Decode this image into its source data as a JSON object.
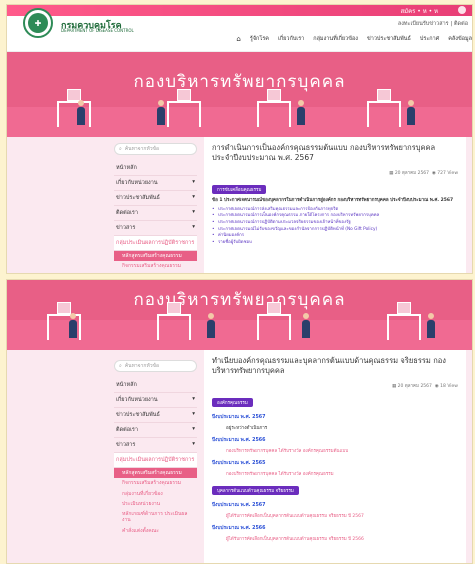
{
  "header": {
    "top_text": "สมัคร • ห • ห",
    "brand": "กรมควบคุมโรค",
    "brand_sub": "DEPARTMENT OF DISEASE CONTROL",
    "util_links": "ลงทะเบียนรับข่าวสาร | ติดต่อ",
    "home_icon": "⌂",
    "menu": [
      "รู้จักโรค",
      "เกี่ยวกับเรา",
      "กลุ่มงานที่เกี่ยวข้อง",
      "ข่าวประชาสัมพันธ์",
      "ประกาศ",
      "คลังข้อมูล"
    ]
  },
  "hero_title": "กองบริหารทรัพยากรบุคคล",
  "sidebar": {
    "search_placeholder": "ค้นหาจากหัวข้อ",
    "items": [
      "หน้าหลัก",
      "เกี่ยวกับหน่วยงาน",
      "ข่าวประชาสัมพันธ์",
      "ติดต่อเรา",
      "ข่าวสาร"
    ],
    "active": "กลุ่มประเมินผลการปฏิบัติราชการ",
    "sub1": "หลักสูตรเสริมสร้างคุณธรรม",
    "sub2": "กิจกรรมเสริมสร้างคุณธรรม",
    "sub3": "กลุ่มงานที่เกี่ยวข้อง",
    "sub4": "ประเมินหน่วยงาน",
    "sub5": "หลักเกณฑ์ด้านการ ประเมินผลงาน",
    "sub6": "คำสั่งแต่งตั้งคณะ"
  },
  "page1": {
    "title": "การดำเนินการเป็นองค์กรคุณธรรมต้นแบบ กองบริหารทรัพยากรบุคคล ประจำปีงบประมาณ พ.ศ. 2567",
    "date": "20 ตุลาคม 2567",
    "views": "727 View",
    "tag": "การขับเคลื่อนคุณธรรม",
    "intro": "ข้อ 1 ประกาศเจตนารมณ์ของบุคลากรในการดำเนินการสู่องค์กร กองบริหารทรัพยากรบุคคล ประจำปีงบประมาณ พ.ศ. 2567",
    "bullets": [
      "ประกาศเจตนารมณ์การส่งเสริมคุณธรรมและการป้องกันการทุจริต",
      "ประกาศเจตนารมณ์การเป็นองค์กรคุณธรรม ภายใต้โครงการ กองบริหารทรัพยากรบุคคล",
      "ประกาศเจตนารมณ์การปฏิบัติตามประมวลจริยธรรมของเจ้าหน้าที่ของรัฐ",
      "ประกาศเจตนารมณ์ไม่รับของขวัญและของกำนัลจากการปฏิบัติหน้าที่ (No Gift Policy)",
      "ค่านิยมองค์กร",
      "รายชื่อผู้รับผิดชอบ"
    ]
  },
  "page2": {
    "title": "ทำเนียบองค์กรคุณธรรมและบุคลากรต้นแบบด้านคุณธรรม จริยธรรม กองบริหารทรัพยากรบุคคล",
    "date": "20 ตุลาคม 2567",
    "views": "18 View",
    "tag1": "องค์กรคุณธรรม",
    "y1": "ปีงบประมาณ พ.ศ. 2567",
    "y1_item": "อยู่ระหว่างดำเนินการ",
    "y2": "ปีงบประมาณ พ.ศ. 2566",
    "y2_item": "กองบริหารทรัพยากรบุคคล ได้รับรางวัล องค์กรคุณธรรมต้นแบบ",
    "y3": "ปีงบประมาณ พ.ศ. 2565",
    "y3_item": "กองบริหารทรัพยากรบุคคล ได้รับรางวัล องค์กรคุณธรรม",
    "tag2": "บุคลากรต้นแบบด้านคุณธรรม จริยธรรม",
    "y4": "ปีงบประมาณ พ.ศ. 2567",
    "y4_item": "ผู้ได้รับการคัดเลือกเป็นบุคลากรต้นแบบด้านคุณธรรม จริยธรรม ปี 2567",
    "y5": "ปีงบประมาณ พ.ศ. 2566",
    "y5_item": "ผู้ได้รับการคัดเลือกเป็นบุคลากรต้นแบบด้านคุณธรรม จริยธรรม ปี 2566"
  }
}
